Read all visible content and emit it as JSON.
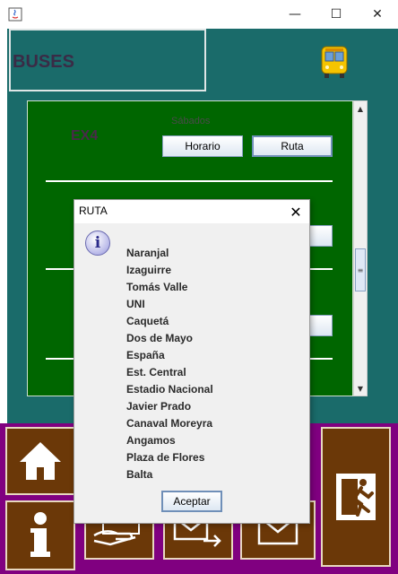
{
  "window": {
    "title": "",
    "controls": {
      "minimize": "—",
      "maximize": "☐",
      "close": "✕"
    }
  },
  "header": {
    "title": "BUSES"
  },
  "panel": {
    "route_code": "EX4",
    "day": "Sábados",
    "buttons": {
      "horario": "Horario",
      "ruta": "Ruta"
    }
  },
  "dialog": {
    "title": "RUTA",
    "close_glyph": "✕",
    "info_glyph": "i",
    "stops": [
      "Naranjal",
      "Izaguirre",
      "Tomás Valle",
      "UNI",
      "Caquetá",
      "Dos de Mayo",
      "España",
      "Est. Central",
      "Estadio Nacional",
      "Javier Prado",
      "Canaval Moreyra",
      "Angamos",
      "Plaza de Flores",
      "Balta"
    ],
    "ok_label": "Aceptar"
  },
  "nav": {
    "icons": [
      "home-icon",
      "info-icon",
      "payment-icon",
      "send-mail-icon",
      "mail-icon",
      "exit-icon"
    ]
  },
  "colors": {
    "teal": "#1a6b6a",
    "green": "#006600",
    "purple": "#800080",
    "brown": "#6b3808"
  }
}
